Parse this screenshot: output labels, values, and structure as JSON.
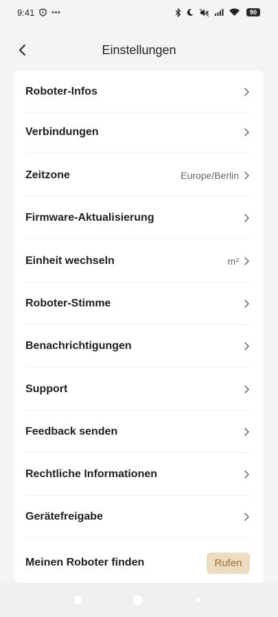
{
  "status_bar": {
    "time": "9:41",
    "battery": "90",
    "left_icons": [
      "shield-icon",
      "more-dots-icon"
    ],
    "right_icons": [
      "bluetooth-icon",
      "moon-icon",
      "mute-icon",
      "signal-icon",
      "wifi-icon"
    ]
  },
  "header": {
    "title": "Einstellungen",
    "back_icon": "chevron-left-icon"
  },
  "settings": {
    "items": [
      {
        "label": "Roboter-Infos",
        "value": ""
      },
      {
        "label": "Verbindungen",
        "value": ""
      },
      {
        "label": "Zeitzone",
        "value": "Europe/Berlin"
      },
      {
        "label": "Firmware-Aktualisierung",
        "value": ""
      },
      {
        "label": "Einheit wechseln",
        "value": "m²"
      },
      {
        "label": "Roboter-Stimme",
        "value": ""
      },
      {
        "label": "Benachrichtigungen",
        "value": ""
      },
      {
        "label": "Support",
        "value": ""
      },
      {
        "label": "Feedback senden",
        "value": ""
      },
      {
        "label": "Rechtliche Informationen",
        "value": ""
      },
      {
        "label": "Gerätefreigabe",
        "value": ""
      }
    ],
    "find_robot": {
      "label": "Meinen Roboter finden",
      "button_label": "Rufen"
    }
  },
  "colors": {
    "background": "#f4f4f4",
    "card": "#ffffff",
    "call_button_bg": "#ecdcc0",
    "call_button_text": "#9a6f33"
  },
  "nav_bar": {
    "icons": [
      "recents-square-icon",
      "home-circle-icon",
      "back-triangle-icon"
    ]
  }
}
